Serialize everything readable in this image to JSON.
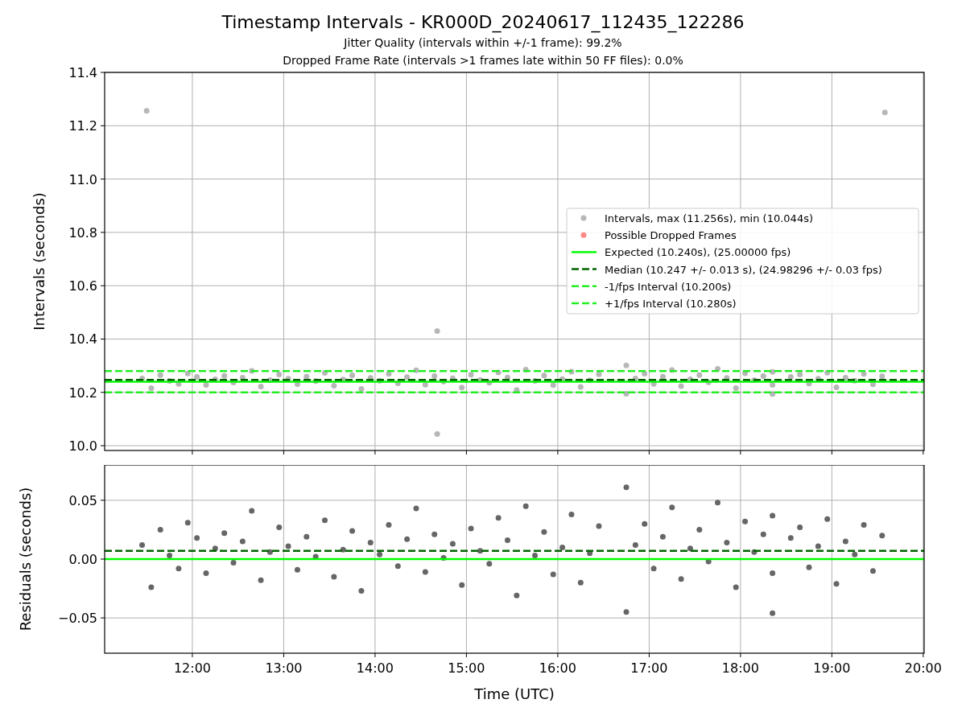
{
  "figure": {
    "title": "Timestamp Intervals - KR000D_20240617_112435_122286",
    "subtitles": [
      "Jitter Quality (intervals within +/-1 frame): 99.2%",
      "Dropped Frame Rate (intervals >1 frames late within 50 FF files): 0.0%"
    ]
  },
  "intervals_panel": {
    "chart_data": {
      "type": "scatter",
      "ylabel": "Intervals (seconds)",
      "xlim": [
        11.04,
        20.01
      ],
      "ylim": [
        9.982,
        11.4
      ],
      "grid": true,
      "legend": "center right",
      "yticks": [
        {
          "value": 10.0,
          "label": "10.0"
        },
        {
          "value": 10.2,
          "label": "10.2"
        },
        {
          "value": 10.4,
          "label": "10.4"
        },
        {
          "value": 10.6,
          "label": "10.6"
        },
        {
          "value": 10.8,
          "label": "10.8"
        },
        {
          "value": 11.0,
          "label": "11.0"
        },
        {
          "value": 11.2,
          "label": "11.2"
        },
        {
          "value": 11.4,
          "label": "11.4"
        }
      ],
      "x": [
        11.45,
        11.55,
        11.65,
        11.75,
        11.85,
        11.95,
        12.05,
        12.15,
        12.25,
        12.35,
        12.45,
        12.55,
        12.65,
        12.75,
        12.85,
        12.95,
        13.05,
        13.15,
        13.25,
        13.35,
        13.45,
        13.55,
        13.65,
        13.75,
        13.85,
        13.95,
        14.05,
        14.15,
        14.25,
        14.35,
        14.45,
        14.55,
        14.65,
        14.75,
        14.85,
        14.95,
        15.05,
        15.15,
        15.25,
        15.35,
        15.45,
        15.55,
        15.65,
        15.75,
        15.85,
        15.95,
        16.05,
        16.15,
        16.25,
        16.35,
        16.45,
        16.75,
        16.75,
        16.85,
        16.95,
        17.05,
        17.15,
        17.25,
        17.35,
        17.45,
        17.55,
        17.65,
        17.75,
        17.85,
        17.95,
        18.05,
        18.15,
        18.25,
        18.35,
        18.35,
        18.35,
        18.55,
        18.65,
        18.75,
        18.85,
        18.95,
        19.05,
        19.15,
        19.25,
        19.35,
        19.45,
        19.55,
        11.5,
        19.58,
        14.68,
        14.68
      ],
      "series": [
        {
          "name": "Intervals, max (11.256s), min (10.044s)",
          "color": "#999999",
          "values": [
            10.252,
            10.216,
            10.265,
            10.243,
            10.232,
            10.271,
            10.258,
            10.228,
            10.249,
            10.262,
            10.237,
            10.255,
            10.281,
            10.222,
            10.246,
            10.267,
            10.251,
            10.231,
            10.259,
            10.242,
            10.273,
            10.225,
            10.248,
            10.264,
            10.213,
            10.254,
            10.244,
            10.269,
            10.234,
            10.257,
            10.283,
            10.229,
            10.261,
            10.241,
            10.253,
            10.218,
            10.266,
            10.247,
            10.236,
            10.275,
            10.256,
            10.209,
            10.285,
            10.243,
            10.263,
            10.227,
            10.25,
            10.278,
            10.22,
            10.245,
            10.268,
            10.301,
            10.195,
            10.252,
            10.27,
            10.232,
            10.259,
            10.284,
            10.223,
            10.249,
            10.265,
            10.238,
            10.288,
            10.254,
            10.216,
            10.272,
            10.246,
            10.261,
            10.228,
            10.277,
            10.194,
            10.258,
            10.267,
            10.233,
            10.251,
            10.274,
            10.219,
            10.255,
            10.244,
            10.269,
            10.23,
            10.26,
            11.256,
            11.25,
            10.43,
            10.044
          ]
        },
        {
          "name": "Possible Dropped Frames",
          "color": "#ff5555",
          "values": [
            null,
            null,
            null,
            null,
            null,
            null,
            null,
            null,
            null,
            null,
            null,
            null,
            null,
            null,
            null,
            null,
            null,
            null,
            null,
            null,
            null,
            null,
            null,
            null,
            null,
            null,
            null,
            null,
            null,
            null,
            null,
            null,
            null,
            null,
            null,
            null,
            null,
            null,
            null,
            null,
            null,
            null,
            null,
            null,
            null,
            null,
            null,
            null,
            null,
            null,
            null,
            null,
            null,
            null,
            null,
            null,
            null,
            null,
            null,
            null,
            null,
            null,
            null,
            null,
            null,
            null,
            null,
            null,
            null,
            null,
            null,
            null,
            null,
            null,
            null,
            null,
            null,
            null,
            null,
            null,
            null,
            null,
            null,
            null,
            null,
            null
          ]
        }
      ],
      "ref_lines": [
        {
          "label": "Expected (10.240s), (25.00000 fps)",
          "color": "#00ff00",
          "axis": "y",
          "value": 10.24
        },
        {
          "label": "Median (10.247 +/- 0.013 s), (24.98296 +/- 0.03 fps)",
          "color": "#006400",
          "axis": "y",
          "value": 10.247
        },
        {
          "label": "-1/fps Interval (10.200s)",
          "color": "#22ee22",
          "axis": "y",
          "value": 10.2
        },
        {
          "label": "+1/fps Interval (10.280s)",
          "color": "#22ee22",
          "axis": "y",
          "value": 10.28
        }
      ]
    }
  },
  "residuals_panel": {
    "chart_data": {
      "type": "scatter",
      "xlabel": "Time (UTC)",
      "ylabel": "Residuals (seconds)",
      "xlim": [
        11.04,
        20.01
      ],
      "ylim": [
        -0.08,
        0.08
      ],
      "grid": true,
      "xticks": [
        {
          "value": 12,
          "label": "12:00"
        },
        {
          "value": 13,
          "label": "13:00"
        },
        {
          "value": 14,
          "label": "14:00"
        },
        {
          "value": 15,
          "label": "15:00"
        },
        {
          "value": 16,
          "label": "16:00"
        },
        {
          "value": 17,
          "label": "17:00"
        },
        {
          "value": 18,
          "label": "18:00"
        },
        {
          "value": 19,
          "label": "19:00"
        },
        {
          "value": 20,
          "label": "20:00"
        }
      ],
      "yticks": [
        {
          "value": -0.05,
          "label": "−0.05"
        },
        {
          "value": 0,
          "label": "0.00"
        },
        {
          "value": 0.05,
          "label": "0.05"
        }
      ],
      "x": [
        11.45,
        11.55,
        11.65,
        11.75,
        11.85,
        11.95,
        12.05,
        12.15,
        12.25,
        12.35,
        12.45,
        12.55,
        12.65,
        12.75,
        12.85,
        12.95,
        13.05,
        13.15,
        13.25,
        13.35,
        13.45,
        13.55,
        13.65,
        13.75,
        13.85,
        13.95,
        14.05,
        14.15,
        14.25,
        14.35,
        14.45,
        14.55,
        14.65,
        14.75,
        14.85,
        14.95,
        15.05,
        15.15,
        15.25,
        15.35,
        15.45,
        15.55,
        15.65,
        15.75,
        15.85,
        15.95,
        16.05,
        16.15,
        16.25,
        16.35,
        16.45,
        16.75,
        16.75,
        16.85,
        16.95,
        17.05,
        17.15,
        17.25,
        17.35,
        17.45,
        17.55,
        17.65,
        17.75,
        17.85,
        17.95,
        18.05,
        18.15,
        18.25,
        18.35,
        18.35,
        18.35,
        18.55,
        18.65,
        18.75,
        18.85,
        18.95,
        19.05,
        19.15,
        19.25,
        19.35,
        19.45,
        19.55
      ],
      "series": [
        {
          "color": "#666666",
          "values": [
            0.012,
            -0.024,
            0.025,
            0.003,
            -0.008,
            0.031,
            0.018,
            -0.012,
            0.009,
            0.022,
            -0.003,
            0.015,
            0.041,
            -0.018,
            0.006,
            0.027,
            0.011,
            -0.009,
            0.019,
            0.002,
            0.033,
            -0.015,
            0.008,
            0.024,
            -0.027,
            0.014,
            0.004,
            0.029,
            -0.006,
            0.017,
            0.043,
            -0.011,
            0.021,
            0.001,
            0.013,
            -0.022,
            0.026,
            0.007,
            -0.004,
            0.035,
            0.016,
            -0.031,
            0.045,
            0.003,
            0.023,
            -0.013,
            0.01,
            0.038,
            -0.02,
            0.005,
            0.028,
            0.061,
            -0.045,
            0.012,
            0.03,
            -0.008,
            0.019,
            0.044,
            -0.017,
            0.009,
            0.025,
            -0.002,
            0.048,
            0.014,
            -0.024,
            0.032,
            0.006,
            0.021,
            -0.012,
            0.037,
            -0.046,
            0.018,
            0.027,
            -0.007,
            0.011,
            0.034,
            -0.021,
            0.015,
            0.004,
            0.029,
            -0.01,
            0.02
          ]
        }
      ],
      "ref_lines": [
        {
          "color": "#00ff00",
          "axis": "y",
          "value": 0
        },
        {
          "color": "#006400",
          "axis": "y",
          "value": 0.007
        }
      ]
    }
  }
}
